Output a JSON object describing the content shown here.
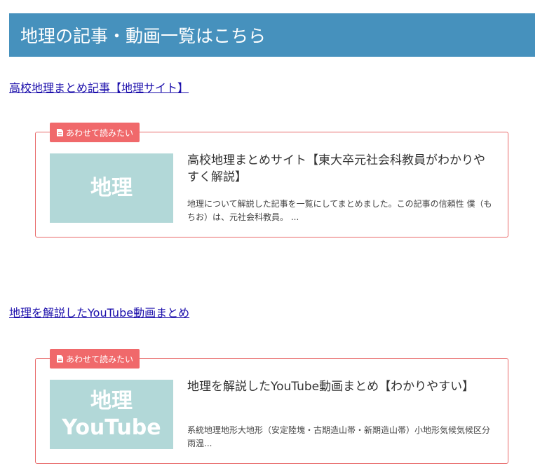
{
  "header": {
    "title": "地理の記事・動画一覧はこちら"
  },
  "links": [
    {
      "text": "高校地理まとめ記事【地理サイト】"
    },
    {
      "text": "地理を解説したYouTube動画まとめ"
    }
  ],
  "cards": [
    {
      "badge": "あわせて読みたい",
      "thumb_line1": "地理",
      "thumb_line2": "",
      "title": "高校地理まとめサイト【東大卒元社会科教員がわかりやすく解説】",
      "desc": "地理について解説した記事を一覧にしてまとめました。この記事の信頼性 僕（もちお）は、元社会科教員。 ..."
    },
    {
      "badge": "あわせて読みたい",
      "thumb_line1": "地理",
      "thumb_line2": "YouTube",
      "title": "地理を解説したYouTube動画まとめ【わかりやすい】",
      "desc": "系統地理地形大地形（安定陸塊・古期造山帯・新期造山帯）小地形気候気候区分雨温..."
    }
  ],
  "colors": {
    "header_bg": "#4691bd",
    "badge_bg": "#f0696b",
    "card_border": "#e86a6a",
    "thumb_bg": "#b2d8d8",
    "link": "#1a0dab"
  },
  "icons": {
    "badge_icon": "document-icon"
  }
}
